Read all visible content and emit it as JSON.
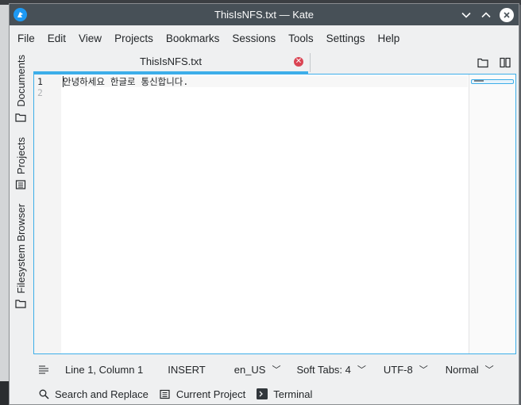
{
  "window": {
    "title": "ThisIsNFS.txt — Kate"
  },
  "menu": {
    "items": [
      "File",
      "Edit",
      "View",
      "Projects",
      "Bookmarks",
      "Sessions",
      "Tools",
      "Settings",
      "Help"
    ]
  },
  "sidebar": {
    "documents_label": "Documents",
    "projects_label": "Projects",
    "filesystem_label": "Filesystem Browser"
  },
  "tabs": {
    "active_label": "ThisIsNFS.txt"
  },
  "editor": {
    "lines": [
      "안녕하세요 한글로 통신합니다.",
      ""
    ],
    "line_numbers": [
      "1",
      "2"
    ]
  },
  "status": {
    "position": "Line 1, Column 1",
    "mode": "INSERT",
    "dictionary": "en_US",
    "indent": "Soft Tabs: 4",
    "encoding": "UTF-8",
    "syntax": "Normal"
  },
  "toolviews": {
    "search": "Search and Replace",
    "project": "Current Project",
    "terminal": "Terminal"
  },
  "colors": {
    "accent": "#3daee9",
    "titlebar": "#475057",
    "close_tab": "#da4453"
  }
}
